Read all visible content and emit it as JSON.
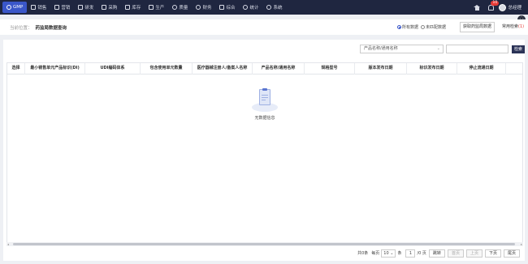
{
  "nav": {
    "items": [
      {
        "label": "GMP",
        "icon": "gmp-icon",
        "active": true
      },
      {
        "label": "销售",
        "icon": "sales-icon"
      },
      {
        "label": "营销",
        "icon": "marketing-icon"
      },
      {
        "label": "研发",
        "icon": "research-icon"
      },
      {
        "label": "采购",
        "icon": "purchase-icon"
      },
      {
        "label": "库存",
        "icon": "inventory-icon"
      },
      {
        "label": "生产",
        "icon": "production-icon"
      },
      {
        "label": "质量",
        "icon": "quality-icon"
      },
      {
        "label": "财务",
        "icon": "finance-icon"
      },
      {
        "label": "综合",
        "icon": "general-icon"
      },
      {
        "label": "统计",
        "icon": "statistics-icon"
      },
      {
        "label": "系统",
        "icon": "system-icon"
      }
    ],
    "notification_count": "10",
    "user_name": "总经理"
  },
  "breadcrumb": {
    "label": "当前位置：",
    "page": "药监局数据查询"
  },
  "filters": {
    "radio_all": "所有数据",
    "radio_unmatched": "未匹配数据",
    "fetch_button": "获取药监局数据",
    "common_tab": "常用检索",
    "common_count": "(1)"
  },
  "search": {
    "select_value": "产品名称/通用名称",
    "input_value": "",
    "button_label": "检索"
  },
  "table": {
    "columns": [
      "选择",
      "最小销售单元产品标识(DI)",
      "UDI编码体系",
      "包含使用单元数量",
      "医疗器械注册人/备案人名称",
      "产品名称/通用名称",
      "规格型号",
      "版本发布日期",
      "标识发布日期",
      "停止流通日期"
    ],
    "empty_text": "无数据信息"
  },
  "pager": {
    "total": "共0条",
    "per_page_label": "每页",
    "per_page_value": "10",
    "unit": "条",
    "page_value": "1",
    "page_total": "/0 页",
    "jump": "跳转",
    "first": "首页",
    "prev": "上页",
    "next": "下页",
    "last": "尾页"
  }
}
